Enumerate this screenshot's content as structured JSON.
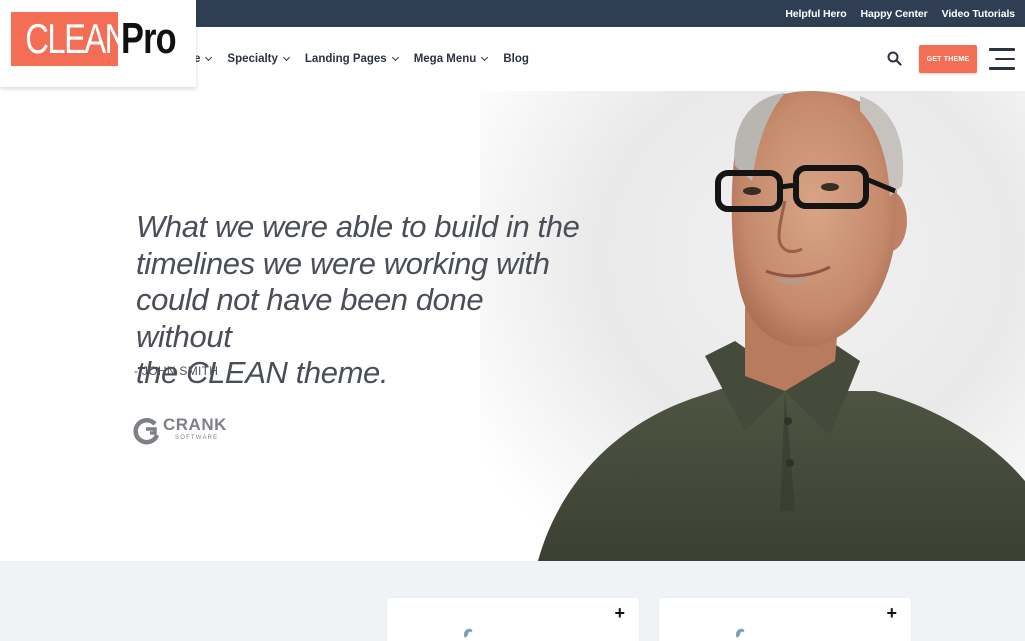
{
  "top_links": [
    "Helpful Hero",
    "Happy Center",
    "Video Tutorials"
  ],
  "logo": {
    "clean": "CLEAN",
    "pro": "Pro"
  },
  "nav": [
    {
      "label": "e",
      "has_caret": true
    },
    {
      "label": "Specialty",
      "has_caret": true
    },
    {
      "label": "Landing Pages",
      "has_caret": true
    },
    {
      "label": "Mega Menu",
      "has_caret": true
    },
    {
      "label": "Blog",
      "has_caret": false
    }
  ],
  "cta_label": "GET THEME",
  "hero": {
    "quote_lines": [
      "What we were able to build in the",
      "timelines we were working with",
      "could not have been done without",
      "the CLEAN theme."
    ],
    "author": "- JOHN SMITH",
    "client_name": "CRANK",
    "client_sub": "SOFTWARE"
  },
  "icons": [
    "search-icon",
    "hamburger-icon",
    "plus-icon",
    "crank-logo-icon"
  ],
  "colors": {
    "topbar": "#2f3e52",
    "accent": "#f46e55",
    "text": "#2c3340",
    "lower_bg": "#eff3f6"
  }
}
